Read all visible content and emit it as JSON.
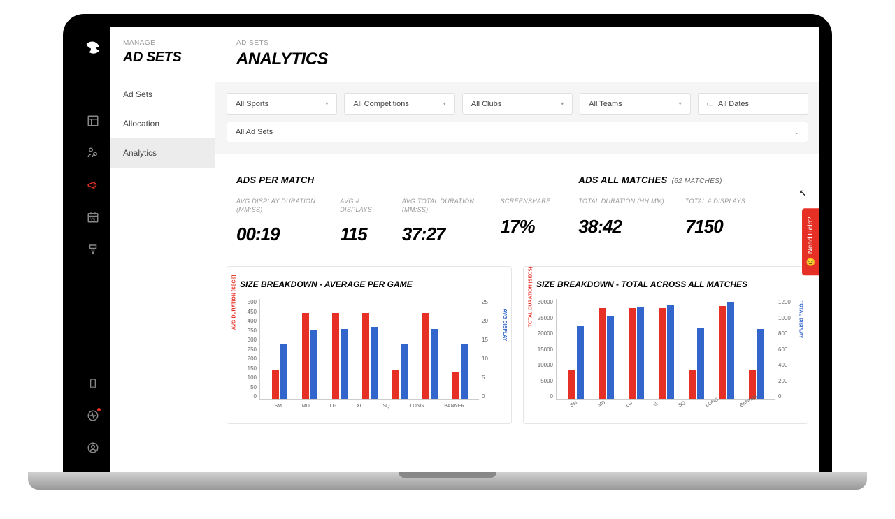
{
  "sidebar": {
    "manage_label": "MANAGE",
    "section_title": "AD SETS",
    "items": [
      {
        "label": "Ad Sets"
      },
      {
        "label": "Allocation"
      },
      {
        "label": "Analytics"
      }
    ]
  },
  "header": {
    "breadcrumb": "AD SETS",
    "title": "ANALYTICS"
  },
  "filters": {
    "sports": "All Sports",
    "competitions": "All Competitions",
    "clubs": "All Clubs",
    "teams": "All Teams",
    "dates": "All Dates",
    "ad_sets": "All Ad Sets"
  },
  "stats": {
    "per_match": {
      "title": "ADS PER MATCH",
      "metrics": [
        {
          "label": "AVG DISPLAY DURATION (MM:SS)",
          "value": "00:19"
        },
        {
          "label": "AVG # DISPLAYS",
          "value": "115"
        },
        {
          "label": "AVG TOTAL DURATION (MM:SS)",
          "value": "37:27"
        },
        {
          "label": "SCREENSHARE",
          "value": "17%"
        }
      ]
    },
    "all_matches": {
      "title": "ADS ALL MATCHES",
      "subtitle": "(62 MATCHES)",
      "metrics": [
        {
          "label": "TOTAL DURATION (HH:MM)",
          "value": "38:42"
        },
        {
          "label": "TOTAL # DISPLAYS",
          "value": "7150"
        }
      ]
    }
  },
  "help_label": "Need Help?",
  "chart_data": [
    {
      "type": "bar",
      "title": "SIZE BREAKDOWN - AVERAGE PER GAME",
      "categories": [
        "SM",
        "MD",
        "LG",
        "XL",
        "SQ",
        "LONG",
        "BANNER"
      ],
      "y_left_label": "AVG DURATION (SECS)",
      "y_right_label": "AVG DISPLAY",
      "y_left_ticks": [
        0,
        50,
        100,
        150,
        200,
        250,
        300,
        350,
        400,
        450,
        500
      ],
      "y_right_ticks": [
        0,
        5,
        10,
        15,
        20,
        25
      ],
      "series": [
        {
          "name": "AVG DURATION (SECS)",
          "axis": "left",
          "color": "#e63025",
          "values": [
            150,
            440,
            440,
            440,
            150,
            440,
            140
          ]
        },
        {
          "name": "AVG DISPLAY",
          "axis": "right",
          "color": "#3366cc",
          "values": [
            14,
            17.5,
            18,
            18.5,
            14,
            18,
            14
          ]
        }
      ],
      "ylim_left": [
        0,
        500
      ],
      "ylim_right": [
        0,
        25
      ]
    },
    {
      "type": "bar",
      "title": "SIZE BREAKDOWN - TOTAL ACROSS ALL MATCHES",
      "categories": [
        "SM",
        "MD",
        "LG",
        "XL",
        "SQ",
        "LONG",
        "BANNER"
      ],
      "y_left_label": "TOTAL DURATION (SECS)",
      "y_right_label": "TOTAL DISPLAY",
      "y_left_ticks": [
        0,
        5000,
        10000,
        15000,
        20000,
        25000,
        30000
      ],
      "y_right_ticks": [
        0,
        200,
        400,
        600,
        800,
        1000,
        1200
      ],
      "series": [
        {
          "name": "TOTAL DURATION (SECS)",
          "axis": "left",
          "color": "#e63025",
          "values": [
            9000,
            28000,
            28000,
            28000,
            9000,
            28500,
            9000
          ]
        },
        {
          "name": "TOTAL DISPLAY",
          "axis": "right",
          "color": "#3366cc",
          "values": [
            900,
            1020,
            1130,
            1160,
            870,
            1190,
            860
          ]
        }
      ],
      "ylim_left": [
        0,
        30000
      ],
      "ylim_right": [
        0,
        1200
      ]
    }
  ]
}
